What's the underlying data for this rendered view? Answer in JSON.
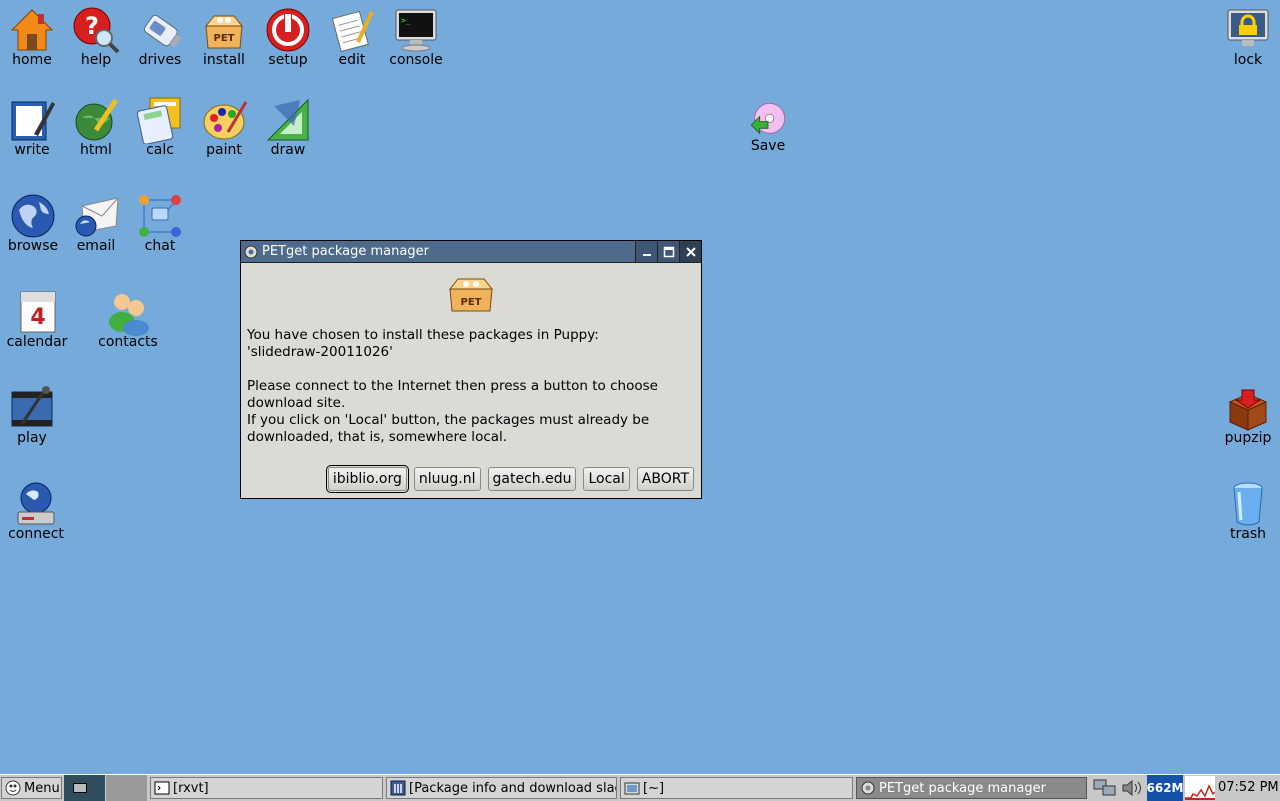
{
  "desktop": {
    "icons": [
      {
        "label": "home",
        "icon": "home-icon"
      },
      {
        "label": "help",
        "icon": "help-icon"
      },
      {
        "label": "drives",
        "icon": "drives-icon"
      },
      {
        "label": "install",
        "icon": "install-icon"
      },
      {
        "label": "setup",
        "icon": "setup-icon"
      },
      {
        "label": "edit",
        "icon": "edit-icon"
      },
      {
        "label": "console",
        "icon": "console-icon"
      },
      {
        "label": "lock",
        "icon": "lock-icon"
      },
      {
        "label": "write",
        "icon": "write-icon"
      },
      {
        "label": "html",
        "icon": "html-icon"
      },
      {
        "label": "calc",
        "icon": "calc-icon"
      },
      {
        "label": "paint",
        "icon": "paint-icon"
      },
      {
        "label": "draw",
        "icon": "draw-icon"
      },
      {
        "label": "Save",
        "icon": "save-icon"
      },
      {
        "label": "browse",
        "icon": "browse-icon"
      },
      {
        "label": "email",
        "icon": "email-icon"
      },
      {
        "label": "chat",
        "icon": "chat-icon"
      },
      {
        "label": "calendar",
        "icon": "calendar-icon"
      },
      {
        "label": "contacts",
        "icon": "contacts-icon"
      },
      {
        "label": "play",
        "icon": "play-icon"
      },
      {
        "label": "connect",
        "icon": "connect-icon"
      },
      {
        "label": "pupzip",
        "icon": "pupzip-icon"
      },
      {
        "label": "trash",
        "icon": "trash-icon"
      }
    ]
  },
  "dialog": {
    "title": "PETget package manager",
    "line1": "You have chosen to install these packages in Puppy:",
    "line2": "'slidedraw-20011026'",
    "line3": "Please connect to the Internet then press a button to choose download site.",
    "line4": "If you click on 'Local' button, the packages must already be downloaded, that is, somewhere local.",
    "buttons": [
      "ibiblio.org",
      "nluug.nl",
      "gatech.edu",
      "Local",
      "ABORT"
    ]
  },
  "taskbar": {
    "menu_label": "Menu",
    "tasks": [
      "[rxvt]",
      "[Package info and download slac",
      "[~]",
      "PETget package manager"
    ],
    "memory": "662M",
    "clock": "07:52 PM"
  },
  "colors": {
    "desktop": "#75aadb",
    "titlebar": "#4f6b8c",
    "dialog_bg": "#dcdad5",
    "taskbar": "#c8c8c8"
  }
}
